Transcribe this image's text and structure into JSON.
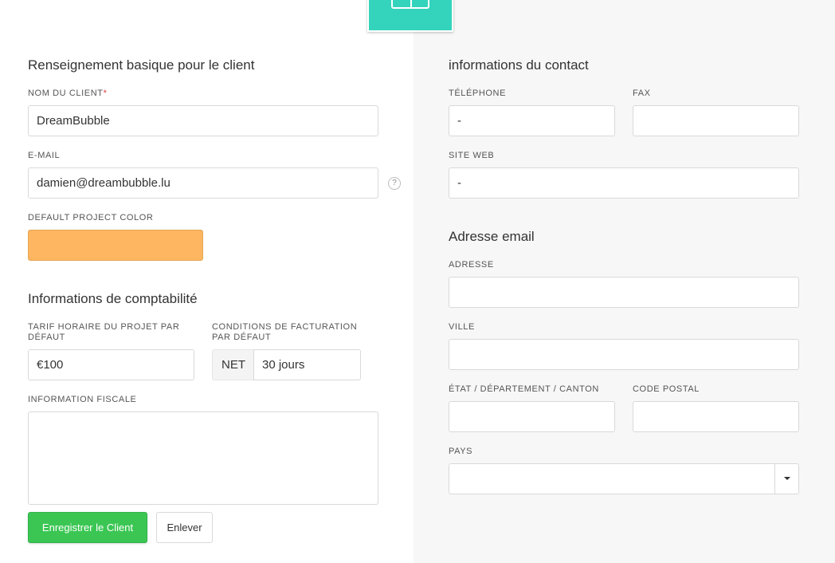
{
  "basic": {
    "heading": "Renseignement basique pour le client",
    "client_name_label": "NOM DU CLIENT",
    "required_mark": "*",
    "client_name_value": "DreamBubble",
    "email_label": "E-MAIL",
    "email_value": "damien@dreambubble.lu",
    "help_symbol": "?",
    "color_label": "DEFAULT PROJECT COLOR",
    "project_color": "#ffb660"
  },
  "accounting": {
    "heading": "Informations de comptabilité",
    "rate_label": "TARIF HORAIRE DU PROJET PAR DÉFAUT",
    "rate_value": "€100",
    "terms_label": "CONDITIONS DE FACTURATION PAR DÉFAUT",
    "terms_prefix": "NET",
    "terms_value": "30 jours",
    "tax_label": "INFORMATION FISCALE",
    "tax_value": ""
  },
  "contact": {
    "heading": "informations du contact",
    "phone_label": "TÉLÉPHONE",
    "phone_value": "-",
    "fax_label": "FAX",
    "fax_value": "",
    "website_label": "SITE WEB",
    "website_value": "-"
  },
  "address": {
    "heading": "Adresse email",
    "street_label": "ADRESSE",
    "street_value": "",
    "city_label": "VILLE",
    "city_value": "",
    "state_label": "ÉTAT / DÉPARTEMENT / CANTON",
    "state_value": "",
    "zip_label": "CODE POSTAL",
    "zip_value": "",
    "country_label": "PAYS",
    "country_value": ""
  },
  "actions": {
    "save_label": "Enregistrer le Client",
    "remove_label": "Enlever"
  },
  "icons": {
    "logo": "app-logo-icon",
    "help": "question-icon",
    "caret": "chevron-down-icon"
  },
  "colors": {
    "brand": "#33d3bc",
    "primary_button": "#3bc653",
    "required": "#e23b3b"
  }
}
